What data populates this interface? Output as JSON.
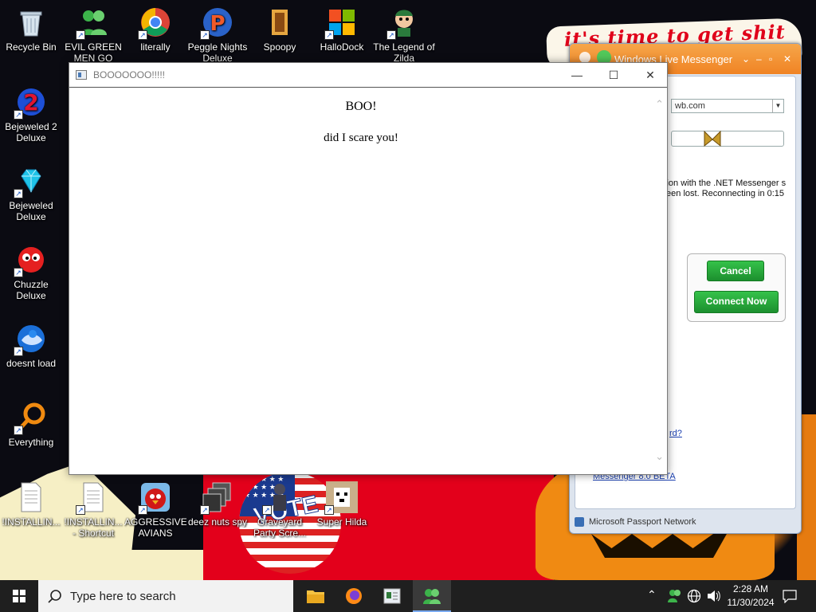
{
  "wallpaper": {
    "banner_text": "it's time to get shit",
    "vote_text": "VOTE"
  },
  "desktop_icons": [
    {
      "label": "Recycle Bin"
    },
    {
      "label": "EVIL GREEN MEN GO"
    },
    {
      "label": "literally"
    },
    {
      "label": "Peggle Nights Deluxe"
    },
    {
      "label": "Spoopy"
    },
    {
      "label": "HalloDock"
    },
    {
      "label": "The Legend of Zilda"
    },
    {
      "label": "Bejeweled 2 Deluxe"
    },
    {
      "label": "Bejeweled Deluxe"
    },
    {
      "label": "Chuzzle Deluxe"
    },
    {
      "label": "doesnt load"
    },
    {
      "label": "Everything"
    },
    {
      "label": "!INSTALLIN..."
    },
    {
      "label": "!INSTALLIN... - Shortcut"
    },
    {
      "label": "AGGRESSIVE AVIANS"
    },
    {
      "label": "deez nuts spy"
    },
    {
      "label": "Graveyard Party Scre..."
    },
    {
      "label": "Super Hilda"
    }
  ],
  "messenger": {
    "title": "Windows Live Messenger",
    "account_suffix": "wb.com",
    "message": "ction with the .NET Messenger s been lost. Reconnecting in 0:15",
    "cancel_label": "Cancel",
    "connect_label": "Connect Now",
    "link_forgot": "rd?",
    "link_beta": "Messenger 8.0 BETA",
    "footer": "Microsoft Passport Network"
  },
  "window": {
    "title": "BOOOOOOO!!!!!",
    "heading": "BOO!",
    "body": "did I scare you!",
    "minimize": "—",
    "maximize": "☐",
    "close": "✕"
  },
  "taskbar": {
    "search_placeholder": "Type here to search",
    "time": "2:28 AM",
    "date": "11/30/2024"
  }
}
